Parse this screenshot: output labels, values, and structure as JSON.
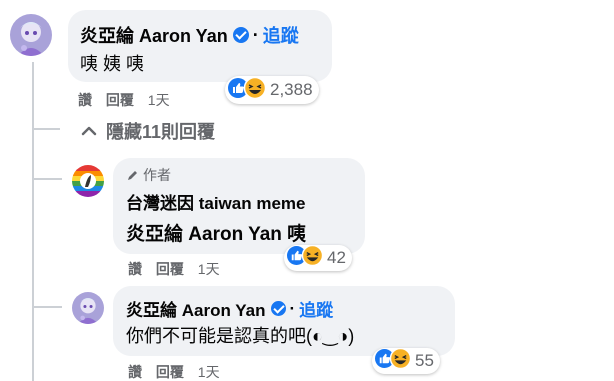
{
  "comment_main": {
    "author": "炎亞綸 Aaron Yan",
    "follow_label": "追蹤",
    "separator": "·",
    "text": "咦 姨 咦",
    "reaction_count": "2,388",
    "actions": {
      "like": "讚",
      "reply": "回覆",
      "time": "1天"
    }
  },
  "hide_replies_label": "隱藏11則回覆",
  "reply_1": {
    "author_badge": "作者",
    "author": "台灣迷因 taiwan meme",
    "text": "炎亞綸 Aaron Yan 咦",
    "reaction_count": "42",
    "actions": {
      "like": "讚",
      "reply": "回覆",
      "time": "1天"
    }
  },
  "reply_2": {
    "author": "炎亞綸 Aaron Yan",
    "follow_label": "追蹤",
    "separator": "·",
    "text": "你們不可能是認真的吧(◐‿◑)",
    "reaction_count": "55",
    "actions": {
      "like": "讚",
      "reply": "回覆",
      "time": "1天"
    }
  },
  "colors": {
    "link_blue": "#1877f2",
    "bubble_bg": "#f0f2f5",
    "meta_gray": "#65676b",
    "haha_yellow": "#f7b125"
  },
  "icons": [
    "verified-badge-icon",
    "like-reaction-icon",
    "haha-reaction-icon",
    "chevron-up-icon",
    "pen-icon"
  ]
}
